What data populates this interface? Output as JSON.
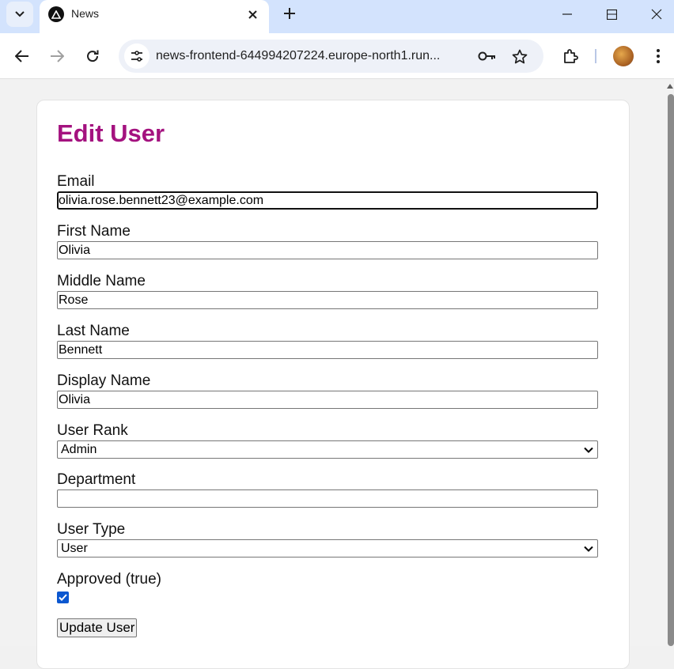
{
  "browser": {
    "tab_title": "News",
    "url": "news-frontend-644994207224.europe-north1.run...",
    "icons": {
      "tab_search": "chevron-down-icon",
      "favicon": "triangle-logo-icon",
      "tab_close": "close-icon",
      "new_tab": "plus-icon",
      "minimize": "minimize-icon",
      "maximize": "maximize-icon",
      "close": "close-icon",
      "back": "arrow-left-icon",
      "forward": "arrow-right-icon",
      "reload": "reload-icon",
      "site_info": "tune-icon",
      "password": "key-icon",
      "bookmark": "star-icon",
      "extensions": "puzzle-icon",
      "profile": "avatar",
      "menu": "kebab-menu-icon"
    }
  },
  "form": {
    "title": "Edit User",
    "title_color": "#a4127f",
    "fields": {
      "email": {
        "label": "Email",
        "value": "olivia.rose.bennett23@example.com"
      },
      "first_name": {
        "label": "First Name",
        "value": "Olivia"
      },
      "middle_name": {
        "label": "Middle Name",
        "value": "Rose"
      },
      "last_name": {
        "label": "Last Name",
        "value": "Bennett"
      },
      "display_name": {
        "label": "Display Name",
        "value": "Olivia"
      },
      "user_rank": {
        "label": "User Rank",
        "value": "Admin"
      },
      "department": {
        "label": "Department",
        "value": ""
      },
      "user_type": {
        "label": "User Type",
        "value": "User"
      },
      "approved": {
        "label": "Approved (true)",
        "checked": true
      }
    },
    "submit_label": "Update User"
  }
}
